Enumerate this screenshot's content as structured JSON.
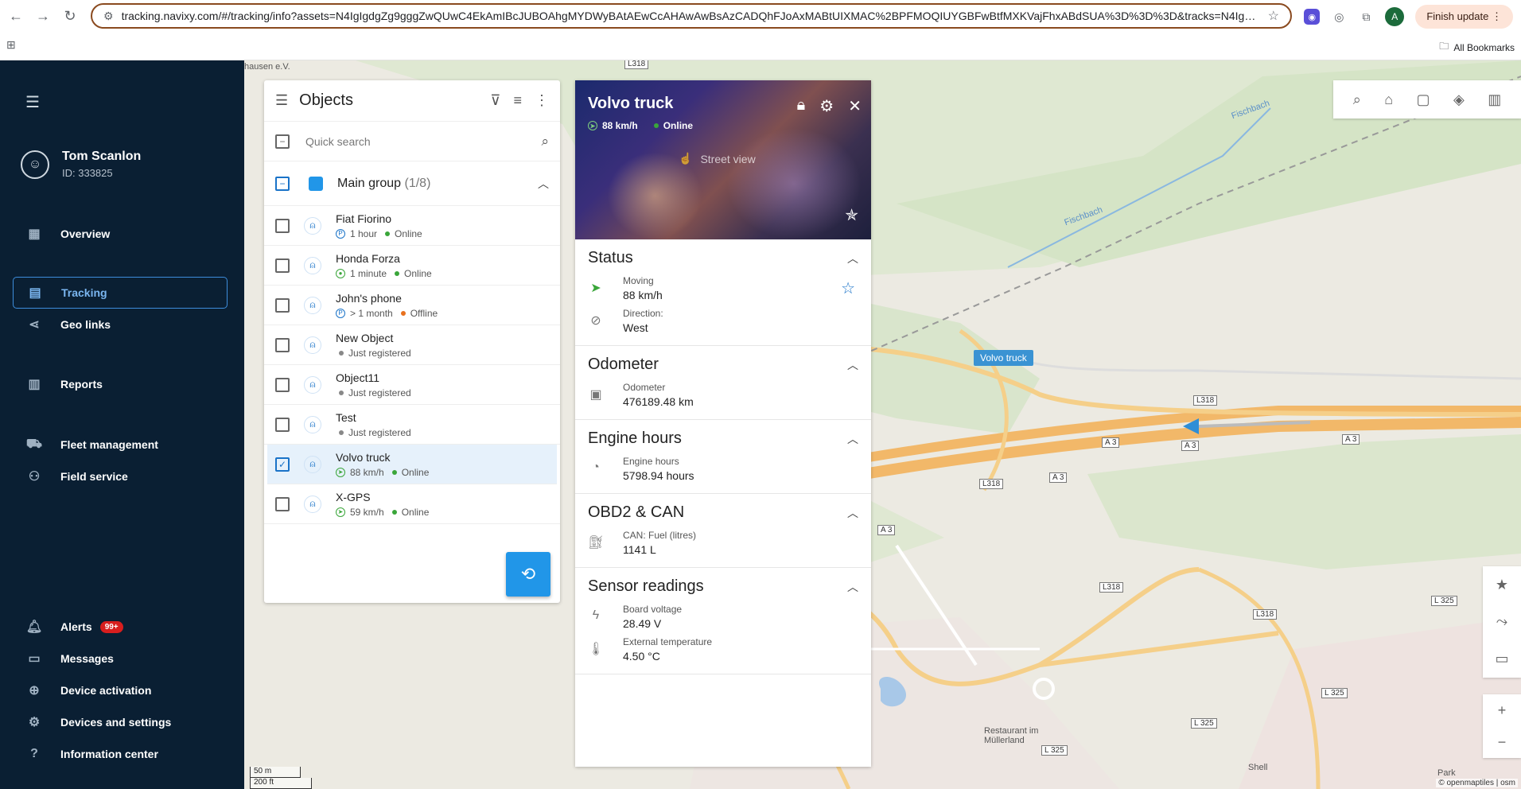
{
  "browser": {
    "url": "tracking.navixy.com/#/tracking/info?assets=N4IgIgdgZg9gggZwQUwC4EkAmIBcJUBOAhgMYDWyBAtAEwCcAHAwAwBsAzCADQhFJoAxMABtUIXMAC%2BPFMOQIUYGBFwBtfMXKVajFhxABdSUA%3D%3D%3D&tracks=N4IgFglgzgLg...",
    "finish_update": "Finish update",
    "profile_letter": "A",
    "all_bookmarks": "All Bookmarks"
  },
  "sidebar": {
    "user_name": "Tom Scanlon",
    "user_id": "ID: 333825",
    "items": [
      {
        "label": "Overview",
        "icon": "dashboard-icon"
      },
      {
        "label": "Tracking",
        "icon": "map-icon"
      },
      {
        "label": "Geo links",
        "icon": "share-icon"
      },
      {
        "label": "Reports",
        "icon": "reports-icon"
      },
      {
        "label": "Fleet management",
        "icon": "car-icon"
      },
      {
        "label": "Field service",
        "icon": "group-icon"
      },
      {
        "label": "Alerts",
        "icon": "bell-icon",
        "badge": "99+"
      },
      {
        "label": "Messages",
        "icon": "message-icon"
      },
      {
        "label": "Device activation",
        "icon": "device-plus-icon"
      },
      {
        "label": "Devices and settings",
        "icon": "gear-icon"
      },
      {
        "label": "Information center",
        "icon": "help-icon"
      }
    ]
  },
  "objects": {
    "title": "Objects",
    "search_placeholder": "Quick search",
    "group_name": "Main group",
    "group_count": "(1/8)",
    "items": [
      {
        "name": "Fiat Fiorino",
        "time": "1 hour",
        "status": "Online",
        "status_color": "#3aa63a",
        "state": "parked"
      },
      {
        "name": "Honda Forza",
        "time": "1 minute",
        "status": "Online",
        "status_color": "#3aa63a",
        "state": "stopped"
      },
      {
        "name": "John's phone",
        "time": "> 1 month",
        "status": "Offline",
        "status_color": "#e8711e",
        "state": "parked"
      },
      {
        "name": "New Object",
        "time": "",
        "status": "Just registered",
        "status_color": "#888888",
        "state": "none"
      },
      {
        "name": "Object11",
        "time": "",
        "status": "Just registered",
        "status_color": "#888888",
        "state": "none"
      },
      {
        "name": "Test",
        "time": "",
        "status": "Just registered",
        "status_color": "#888888",
        "state": "none"
      },
      {
        "name": "Volvo truck",
        "time": "88 km/h",
        "status": "Online",
        "status_color": "#3aa63a",
        "state": "moving",
        "selected": true
      },
      {
        "name": "X-GPS",
        "time": "59 km/h",
        "status": "Online",
        "status_color": "#3aa63a",
        "state": "moving"
      }
    ]
  },
  "detail": {
    "title": "Volvo truck",
    "speed": "88 km/h",
    "status": "Online",
    "street_view": "Street view",
    "status_section": {
      "title": "Status",
      "moving_label": "Moving",
      "moving_value": "88 km/h",
      "direction_label": "Direction:",
      "direction_value": "West"
    },
    "odometer_section": {
      "title": "Odometer",
      "label": "Odometer",
      "value": "476189.48 km"
    },
    "engine_section": {
      "title": "Engine hours",
      "label": "Engine hours",
      "value": "5798.94 hours"
    },
    "obd_section": {
      "title": "OBD2 & CAN",
      "label": "CAN: Fuel (litres)",
      "value": "1141 L"
    },
    "sensor_section": {
      "title": "Sensor readings",
      "voltage_label": "Board voltage",
      "voltage_value": "28.49 V",
      "temp_label": "External temperature",
      "temp_value": "4.50 °C"
    }
  },
  "map": {
    "vehicle_label": "Volvo truck",
    "scale_m": "50 m",
    "scale_ft": "200 ft",
    "attribution": "© openmaptiles | osm",
    "place_labels": [
      "hausen e.V.",
      "Fischbach",
      "Restaurant im Müllerland",
      "Shell",
      "Park"
    ],
    "road_labels": [
      "L318",
      "A 3",
      "L 325"
    ]
  }
}
